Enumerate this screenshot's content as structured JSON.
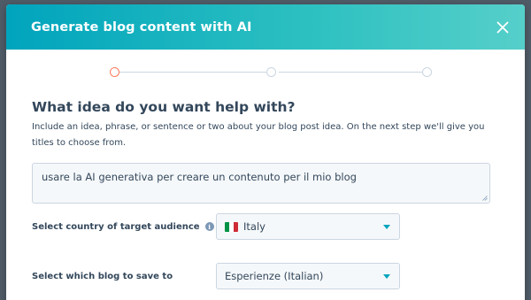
{
  "modal": {
    "title": "Generate blog content with AI",
    "close_icon": "close-icon"
  },
  "stepper": {
    "steps": 3,
    "current_step": 1,
    "active_color": "#ff7a59",
    "inactive_color": "#cbd6e2"
  },
  "idea": {
    "heading": "What idea do you want help with?",
    "help_text": "Include an idea, phrase, or sentence or two about your blog post idea. On the next step we'll give you titles to choose from.",
    "value": "usare la AI generativa per creare un contenuto per il mio blog"
  },
  "country": {
    "label": "Select country of target audience",
    "info_icon": "info-icon",
    "flag_icon": "italy-flag-icon",
    "selected": "Italy"
  },
  "blog": {
    "label": "Select which blog to save to",
    "selected": "Esperienze (Italian)"
  },
  "colors": {
    "header_gradient_start": "#00a4bd",
    "header_gradient_end": "#56cfca",
    "text": "#33475b",
    "caret": "#00a4bd",
    "backdrop": "#4f5b66"
  }
}
